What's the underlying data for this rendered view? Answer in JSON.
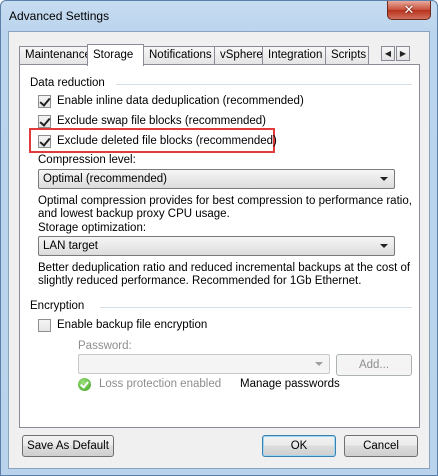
{
  "window": {
    "title": "Advanced Settings",
    "close_glyph": "✕"
  },
  "tabs": [
    {
      "label": "Maintenance"
    },
    {
      "label": "Storage"
    },
    {
      "label": "Notifications"
    },
    {
      "label": "vSphere"
    },
    {
      "label": "Integration"
    },
    {
      "label": "Scripts"
    }
  ],
  "active_tab": "Storage",
  "tab_scroll": {
    "left": "◀",
    "right": "▶"
  },
  "data_reduction": {
    "title": "Data reduction",
    "inline_dedup": {
      "label": "Enable inline data deduplication (recommended)",
      "checked": true
    },
    "exclude_swap": {
      "label": "Exclude swap file blocks (recommended)",
      "checked": true
    },
    "exclude_deleted": {
      "label": "Exclude deleted file blocks (recommended)",
      "checked": true
    },
    "compression_label": "Compression level:",
    "compression_value": "Optimal (recommended)",
    "compression_desc_1": "Optimal compression provides for best compression to performance ratio,",
    "compression_desc_2": "and lowest backup proxy CPU usage.",
    "storage_opt_label": "Storage optimization:",
    "storage_opt_value": "LAN target",
    "storage_desc_1": "Better deduplication ratio and reduced incremental backups at the cost of",
    "storage_desc_2": "slightly reduced performance. Recommended for 1Gb Ethernet."
  },
  "encryption": {
    "title": "Encryption",
    "enable": {
      "label": "Enable backup file encryption",
      "checked": false
    },
    "password_label": "Password:",
    "password_value": "",
    "add_button": "Add...",
    "loss_protection": "Loss protection enabled",
    "manage_passwords": "Manage passwords"
  },
  "footer": {
    "save_default": "Save As Default",
    "ok": "OK",
    "cancel": "Cancel"
  },
  "colors": {
    "highlight": "#e03a3a",
    "accent": "#3c7fb1",
    "success": "#3ba21d"
  }
}
